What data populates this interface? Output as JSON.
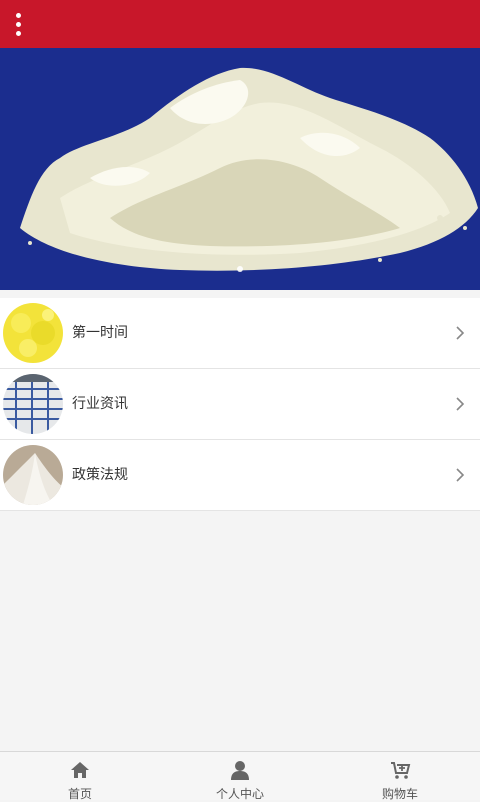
{
  "header": {
    "menu_icon": "more-vertical-icon",
    "background": "#c8172a"
  },
  "banner": {
    "image": "white-powder-pile",
    "background": "#1a2a8a",
    "slides": 1,
    "active_slide": 1
  },
  "list": {
    "items": [
      {
        "label": "第一时间",
        "thumb": "yellow-powder-thumbnail"
      },
      {
        "label": "行业资讯",
        "thumb": "striped-bags-thumbnail"
      },
      {
        "label": "政策法规",
        "thumb": "white-powder-thumbnail"
      }
    ]
  },
  "tabbar": {
    "items": [
      {
        "label": "首页",
        "icon": "home-icon"
      },
      {
        "label": "个人中心",
        "icon": "user-icon"
      },
      {
        "label": "购物车",
        "icon": "cart-icon"
      }
    ]
  }
}
